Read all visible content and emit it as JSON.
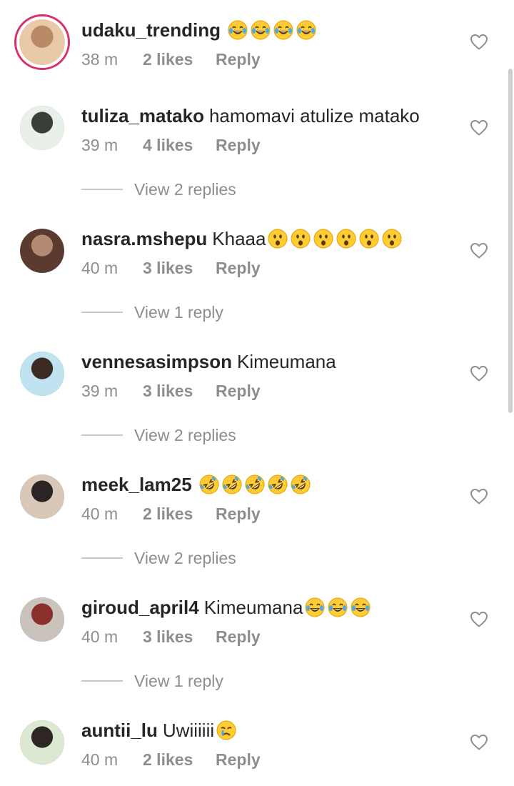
{
  "comments": [
    {
      "username": "udaku_trending",
      "text": "",
      "emojis": [
        "laugh",
        "laugh",
        "laugh",
        "laugh"
      ],
      "time": "38 m",
      "likes": "2 likes",
      "reply": "Reply",
      "view_replies": "",
      "avatar_colors": [
        "#e8c9a8",
        "#b98a67"
      ],
      "story_ring": true
    },
    {
      "username": "tuliza_matako",
      "text": "hamomavi atulize matako",
      "emojis": [],
      "time": "39 m",
      "likes": "4 likes",
      "reply": "Reply",
      "view_replies": "View 2 replies",
      "avatar_colors": [
        "#e9efe9",
        "#3a3f3a"
      ],
      "story_ring": false
    },
    {
      "username": "nasra.mshepu",
      "text": "Khaaa",
      "emojis": [
        "surprised",
        "surprised",
        "surprised",
        "surprised",
        "surprised",
        "surprised"
      ],
      "time": "40 m",
      "likes": "3 likes",
      "reply": "Reply",
      "view_replies": "View 1 reply",
      "avatar_colors": [
        "#5b3b30",
        "#b58a72"
      ],
      "story_ring": false
    },
    {
      "username": "vennesasimpson",
      "text": "Kimeumana",
      "emojis": [],
      "time": "39 m",
      "likes": "3 likes",
      "reply": "Reply",
      "view_replies": "View 2 replies",
      "avatar_colors": [
        "#bfe3f0",
        "#3c2a24"
      ],
      "story_ring": false
    },
    {
      "username": "meek_lam25",
      "text": "",
      "emojis": [
        "rofl",
        "rofl",
        "rofl",
        "rofl",
        "rofl"
      ],
      "time": "40 m",
      "likes": "2 likes",
      "reply": "Reply",
      "view_replies": "View 2 replies",
      "avatar_colors": [
        "#d9c7b8",
        "#2b2424"
      ],
      "story_ring": false
    },
    {
      "username": "giroud_april4",
      "text": "Kimeumana",
      "emojis": [
        "laugh",
        "laugh",
        "laugh"
      ],
      "time": "40 m",
      "likes": "3 likes",
      "reply": "Reply",
      "view_replies": "View 1 reply",
      "avatar_colors": [
        "#c9c3bb",
        "#8a2f2a"
      ],
      "story_ring": false
    },
    {
      "username": "auntii_lu",
      "text": "Uwiiiiii",
      "emojis": [
        "crying"
      ],
      "time": "40 m",
      "likes": "2 likes",
      "reply": "Reply",
      "view_replies": "",
      "avatar_colors": [
        "#dbe8d2",
        "#2e2622"
      ],
      "story_ring": false
    }
  ],
  "icons": {
    "like": "heart-outline-icon",
    "emoji_laugh": "face-with-tears-of-joy",
    "emoji_surprised": "hushed-face",
    "emoji_rofl": "rolling-on-floor-laughing",
    "emoji_crying": "crying-face"
  }
}
